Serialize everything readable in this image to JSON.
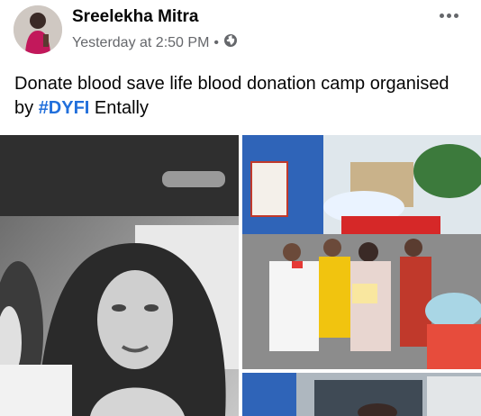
{
  "post": {
    "author": "Sreelekha Mitra",
    "timestamp": "Yesterday at 2:50 PM",
    "separator": "•",
    "audience_icon": "globe-icon",
    "more_icon": "more-options-icon",
    "text_before": "Donate blood save life blood donation camp organised by ",
    "hashtag": "#DYFI",
    "text_after": " Entally"
  },
  "colors": {
    "hashtag": "#216fdb",
    "meta": "#65676b",
    "text": "#050505"
  },
  "photos": {
    "left": "portrait-selfie-in-car",
    "right_top": "blood-donation-camp-crowd",
    "right_bottom": "donation-room"
  }
}
